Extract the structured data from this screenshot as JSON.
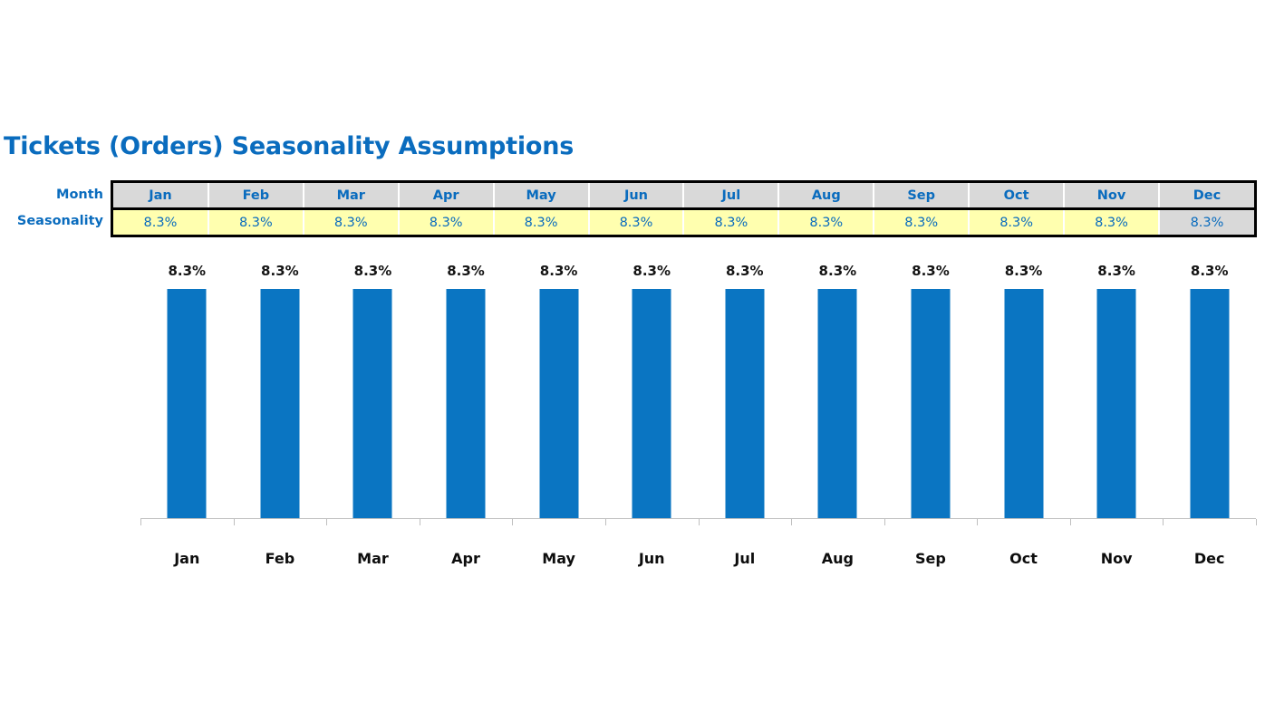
{
  "title": "Tickets (Orders) Seasonality Assumptions",
  "colors": {
    "accent_blue": "#0A6CBE",
    "bar_blue": "#0A75C2",
    "header_gray": "#D9D9D9",
    "input_yellow": "#FFFFAF",
    "axis_gray": "#BFBFBF",
    "label_black": "#0D0D0D",
    "border_black": "#000000"
  },
  "table": {
    "row_labels": {
      "month": "Month",
      "seasonality": "Seasonality"
    },
    "months": [
      "Jan",
      "Feb",
      "Mar",
      "Apr",
      "May",
      "Jun",
      "Jul",
      "Aug",
      "Sep",
      "Oct",
      "Nov",
      "Dec"
    ],
    "seasonality": [
      "8.3%",
      "8.3%",
      "8.3%",
      "8.3%",
      "8.3%",
      "8.3%",
      "8.3%",
      "8.3%",
      "8.3%",
      "8.3%",
      "8.3%",
      "8.3%"
    ],
    "muted_cell_index": 11
  },
  "chart_data": {
    "type": "bar",
    "title": "Tickets (Orders) Seasonality Assumptions",
    "categories": [
      "Jan",
      "Feb",
      "Mar",
      "Apr",
      "May",
      "Jun",
      "Jul",
      "Aug",
      "Sep",
      "Oct",
      "Nov",
      "Dec"
    ],
    "values": [
      8.3,
      8.3,
      8.3,
      8.3,
      8.3,
      8.3,
      8.3,
      8.3,
      8.3,
      8.3,
      8.3,
      8.3
    ],
    "data_labels": [
      "8.3%",
      "8.3%",
      "8.3%",
      "8.3%",
      "8.3%",
      "8.3%",
      "8.3%",
      "8.3%",
      "8.3%",
      "8.3%",
      "8.3%",
      "8.3%"
    ],
    "xlabel": "",
    "ylabel": "",
    "ylim": [
      0,
      9.4
    ],
    "grid": false,
    "legend": false,
    "series": [
      {
        "name": "Seasonality",
        "values": [
          8.3,
          8.3,
          8.3,
          8.3,
          8.3,
          8.3,
          8.3,
          8.3,
          8.3,
          8.3,
          8.3,
          8.3
        ],
        "color": "#0A75C2"
      }
    ]
  }
}
